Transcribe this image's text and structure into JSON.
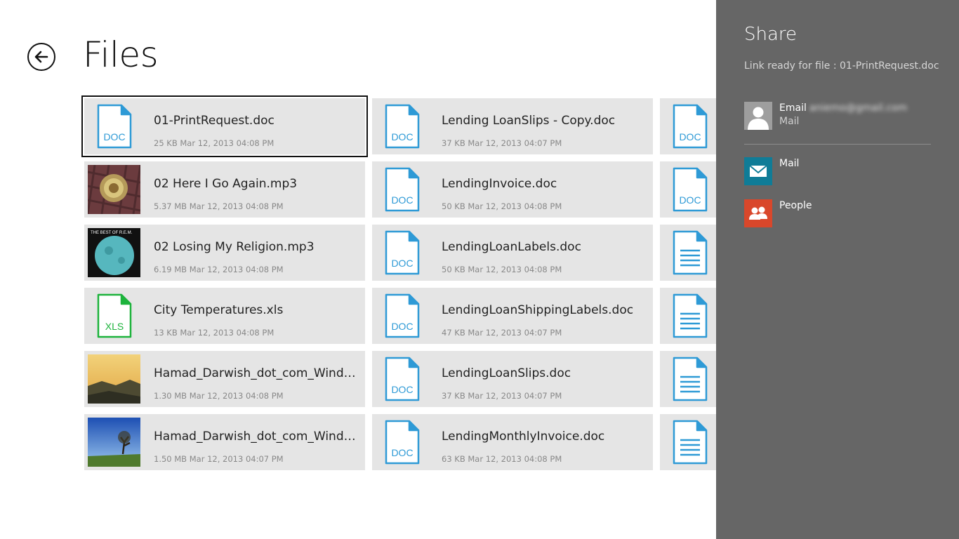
{
  "header": {
    "title": "Files"
  },
  "icons": {
    "back": "back-arrow-icon",
    "doc": "doc-file-icon",
    "xls": "xls-file-icon",
    "text": "text-document-icon",
    "user": "user-avatar-icon",
    "mail": "mail-icon",
    "people": "people-icon"
  },
  "files": [
    {
      "name": "01-PrintRequest.doc",
      "meta": "25 KB Mar 12, 2013 04:08 PM",
      "kind": "doc",
      "selected": true
    },
    {
      "name": "02 Here I Go Again.mp3",
      "meta": "5.37 MB Mar 12, 2013 04:08 PM",
      "kind": "album1"
    },
    {
      "name": "02 Losing My Religion.mp3",
      "meta": "6.19 MB Mar 12, 2013 04:08 PM",
      "kind": "album2",
      "album_text": "THE BEST OF R.E.M."
    },
    {
      "name": "City Temperatures.xls",
      "meta": "13 KB Mar 12, 2013 04:08 PM",
      "kind": "xls"
    },
    {
      "name": "Hamad_Darwish_dot_com_Windows…",
      "meta": "1.30 MB Mar 12, 2013 04:08 PM",
      "kind": "photo1"
    },
    {
      "name": "Hamad_Darwish_dot_com_Windows…",
      "meta": "1.50 MB Mar 12, 2013 04:07 PM",
      "kind": "photo2"
    },
    {
      "name": "Lending LoanSlips - Copy.doc",
      "meta": "37 KB Mar 12, 2013 04:07 PM",
      "kind": "doc"
    },
    {
      "name": "LendingInvoice.doc",
      "meta": "50 KB Mar 12, 2013 04:08 PM",
      "kind": "doc"
    },
    {
      "name": "LendingLoanLabels.doc",
      "meta": "50 KB Mar 12, 2013 04:08 PM",
      "kind": "doc"
    },
    {
      "name": "LendingLoanShippingLabels.doc",
      "meta": "47 KB Mar 12, 2013 04:07 PM",
      "kind": "doc"
    },
    {
      "name": "LendingLoanSlips.doc",
      "meta": "37 KB Mar 12, 2013 04:07 PM",
      "kind": "doc"
    },
    {
      "name": "LendingMonthlyInvoice.doc",
      "meta": "63 KB Mar 12, 2013 04:08 PM",
      "kind": "doc"
    },
    {
      "name": "",
      "meta": "",
      "kind": "doc"
    },
    {
      "name": "",
      "meta": "",
      "kind": "doc"
    },
    {
      "name": "",
      "meta": "",
      "kind": "text"
    },
    {
      "name": "",
      "meta": "",
      "kind": "text"
    },
    {
      "name": "",
      "meta": "",
      "kind": "text"
    },
    {
      "name": "",
      "meta": "",
      "kind": "text"
    }
  ],
  "doc_label": "DOC",
  "xls_label": "XLS",
  "share": {
    "title": "Share",
    "status": "Link ready for file : 01-PrintRequest.doc",
    "contact": {
      "label": "Email",
      "address": "aniemo@gmail.com",
      "app": "Mail"
    },
    "targets": [
      {
        "label": "Mail",
        "color": "#0f7c97"
      },
      {
        "label": "People",
        "color": "#d9472b"
      }
    ]
  },
  "colors": {
    "doc_blue": "#2e9ad6",
    "xls_green": "#1db33c",
    "panel_bg": "#666666",
    "tile_bg": "#e5e5e5"
  }
}
